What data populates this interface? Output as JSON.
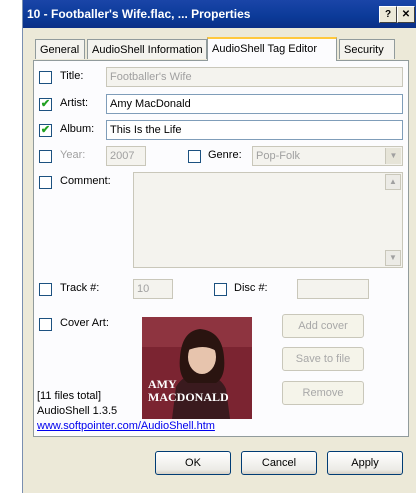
{
  "window": {
    "title": "10 - Footballer's Wife.flac, ... Properties",
    "help_glyph": "?",
    "close_glyph": "✕"
  },
  "tabs": [
    "General",
    "AudioShell Information",
    "AudioShell Tag Editor",
    "Security"
  ],
  "active_tab": "AudioShell Tag Editor",
  "fields": {
    "title": {
      "label": "Title:",
      "value": "Footballer's Wife",
      "checked": false,
      "enabled": false
    },
    "artist": {
      "label": "Artist:",
      "value": "Amy MacDonald",
      "checked": true,
      "enabled": true
    },
    "album": {
      "label": "Album:",
      "value": "This Is the Life",
      "checked": true,
      "enabled": true
    },
    "year": {
      "label": "Year:",
      "value": "2007",
      "checked": false,
      "enabled": false
    },
    "genre": {
      "label": "Genre:",
      "value": "Pop-Folk",
      "checked": false,
      "enabled": false
    },
    "comment": {
      "label": "Comment:",
      "value": "",
      "checked": false,
      "enabled": false
    },
    "track": {
      "label": "Track #:",
      "value": "10",
      "checked": false,
      "enabled": false
    },
    "disc": {
      "label": "Disc #:",
      "value": "",
      "checked": false,
      "enabled": false
    },
    "cover_art": {
      "label": "Cover Art:",
      "checked": false
    }
  },
  "cover": {
    "artist_line1": "AMY",
    "artist_line2": "MACDONALD"
  },
  "cover_buttons": {
    "add": "Add cover",
    "save": "Save to file",
    "remove": "Remove"
  },
  "info": {
    "files_total": "[11 files total]",
    "version": "AudioShell 1.3.5",
    "link": "www.softpointer.com/AudioShell.htm"
  },
  "dialog_buttons": {
    "ok": "OK",
    "cancel": "Cancel",
    "apply": "Apply"
  },
  "colors": {
    "titlebar": "#0b3a98",
    "check": "#21a121",
    "link": "#0000ee"
  },
  "icons": {
    "check": "✔",
    "dropdown": "▼",
    "scroll_up": "▲",
    "scroll_down": "▼"
  }
}
